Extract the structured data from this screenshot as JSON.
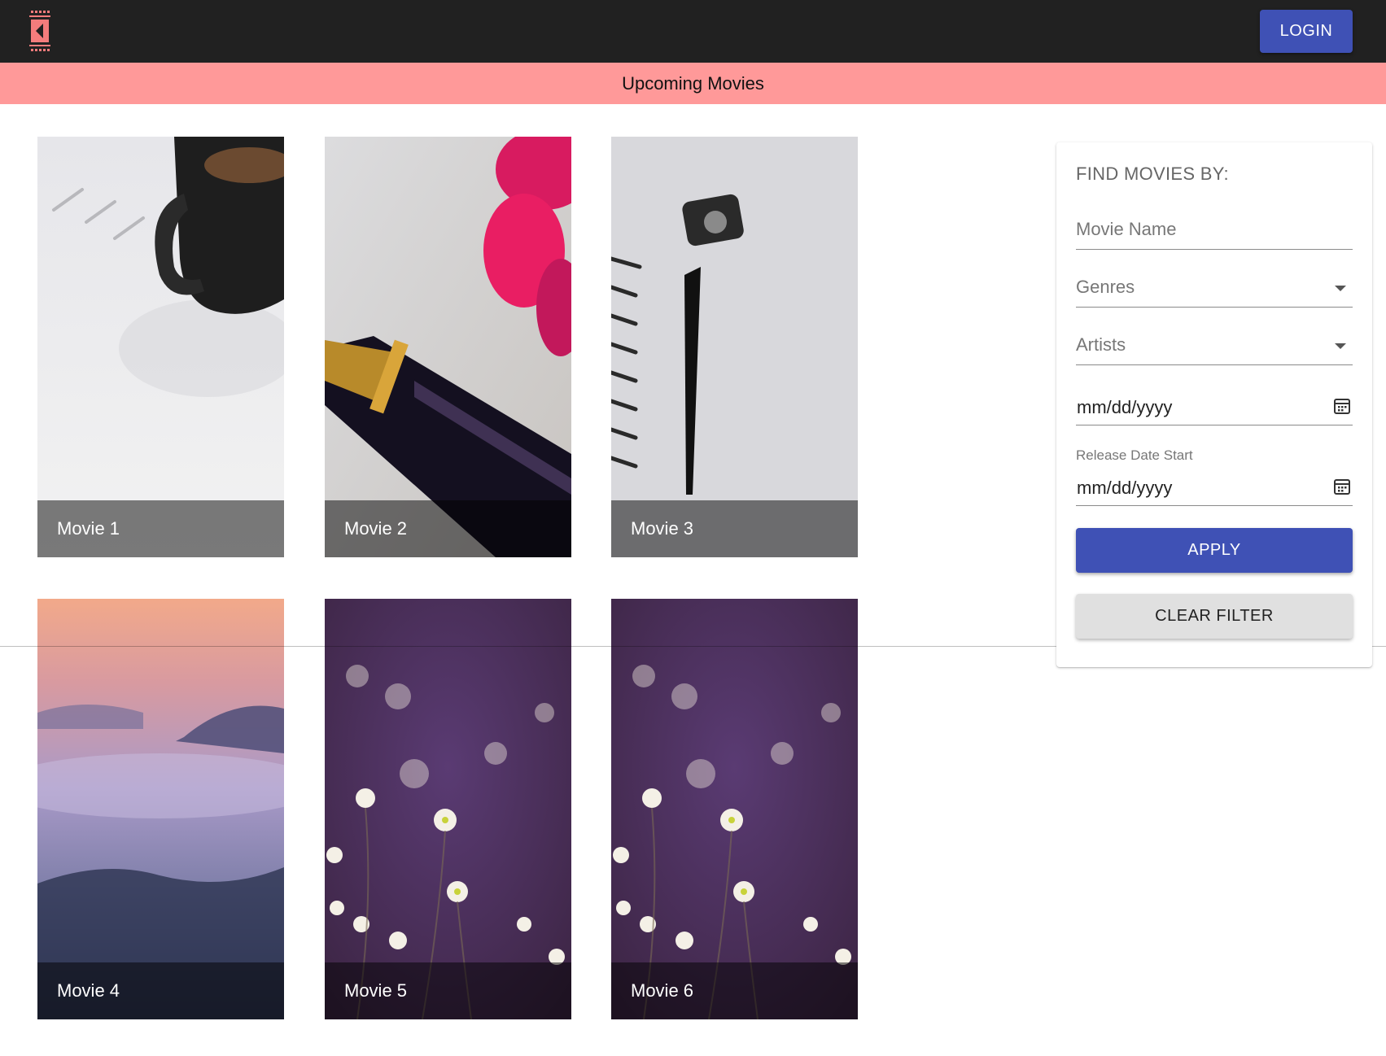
{
  "header": {
    "logo_icon": "film-strip-logo-icon",
    "login_label": "LOGIN",
    "accent_color": "#3f51b5"
  },
  "banner": {
    "title": "Upcoming Movies",
    "background_color": "#ff9999"
  },
  "movies": [
    {
      "title": "Movie 1"
    },
    {
      "title": "Movie 2"
    },
    {
      "title": "Movie 3"
    },
    {
      "title": "Movie 4"
    },
    {
      "title": "Movie 5"
    },
    {
      "title": "Movie 6"
    }
  ],
  "filter": {
    "heading": "FIND MOVIES BY:",
    "movie_name_placeholder": "Movie Name",
    "genres_placeholder": "Genres",
    "artists_placeholder": "Artists",
    "date_end_value": "mm/dd/yyyy",
    "release_date_start_label": "Release Date Start",
    "date_start_value": "mm/dd/yyyy",
    "apply_label": "APPLY",
    "clear_label": "CLEAR FILTER"
  }
}
